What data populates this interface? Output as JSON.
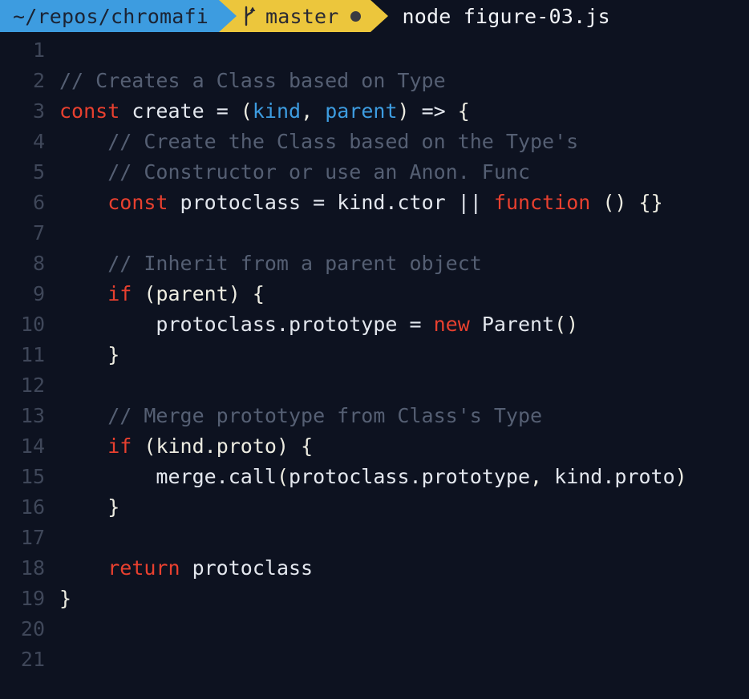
{
  "colors": {
    "background": "#0d1220",
    "path_segment": "#3d9ce0",
    "git_segment": "#ecc63c",
    "keyword": "#e8402f",
    "comment": "#555f73",
    "param": "#3d9ce0",
    "plain_text": "#e3e7ee",
    "line_number": "#3f4759",
    "dirty_dot": "#3a3a42"
  },
  "prompt": {
    "path": "~/repos/chromafi",
    "git_icon": "git-branch-icon",
    "branch": "master",
    "dirty_indicator": "●",
    "command": "node figure-03.js"
  },
  "code": {
    "lines": [
      {
        "number": "1",
        "tokens": []
      },
      {
        "number": "2",
        "tokens": [
          {
            "text": "// Creates a Class based on Type",
            "cls": "t-comment"
          }
        ]
      },
      {
        "number": "3",
        "tokens": [
          {
            "text": "const",
            "cls": "t-keyword"
          },
          {
            "text": " create ",
            "cls": "t-plain"
          },
          {
            "text": "= ",
            "cls": "t-op"
          },
          {
            "text": "(",
            "cls": "t-punct"
          },
          {
            "text": "kind",
            "cls": "t-param"
          },
          {
            "text": ", ",
            "cls": "t-punct"
          },
          {
            "text": "parent",
            "cls": "t-param"
          },
          {
            "text": ")",
            "cls": "t-punct"
          },
          {
            "text": " => ",
            "cls": "t-op"
          },
          {
            "text": "{",
            "cls": "t-punct"
          }
        ]
      },
      {
        "number": "4",
        "tokens": [
          {
            "text": "    // Create the Class based on the Type's",
            "cls": "t-comment"
          }
        ]
      },
      {
        "number": "5",
        "tokens": [
          {
            "text": "    // Constructor or use an Anon. Func",
            "cls": "t-comment"
          }
        ]
      },
      {
        "number": "6",
        "tokens": [
          {
            "text": "    ",
            "cls": "t-plain"
          },
          {
            "text": "const",
            "cls": "t-keyword"
          },
          {
            "text": " protoclass ",
            "cls": "t-plain"
          },
          {
            "text": "= ",
            "cls": "t-op"
          },
          {
            "text": "kind.ctor ",
            "cls": "t-plain"
          },
          {
            "text": "|| ",
            "cls": "t-op"
          },
          {
            "text": "function",
            "cls": "t-keyword"
          },
          {
            "text": " ",
            "cls": "t-plain"
          },
          {
            "text": "()",
            "cls": "t-punct"
          },
          {
            "text": " ",
            "cls": "t-plain"
          },
          {
            "text": "{}",
            "cls": "t-punct"
          }
        ]
      },
      {
        "number": "7",
        "tokens": []
      },
      {
        "number": "8",
        "tokens": [
          {
            "text": "    // Inherit from a parent object",
            "cls": "t-comment"
          }
        ]
      },
      {
        "number": "9",
        "tokens": [
          {
            "text": "    ",
            "cls": "t-plain"
          },
          {
            "text": "if",
            "cls": "t-keyword"
          },
          {
            "text": " ",
            "cls": "t-plain"
          },
          {
            "text": "(parent)",
            "cls": "t-punct"
          },
          {
            "text": " ",
            "cls": "t-plain"
          },
          {
            "text": "{",
            "cls": "t-punct"
          }
        ]
      },
      {
        "number": "10",
        "tokens": [
          {
            "text": "        protoclass.prototype ",
            "cls": "t-plain"
          },
          {
            "text": "= ",
            "cls": "t-op"
          },
          {
            "text": "new",
            "cls": "t-keyword"
          },
          {
            "text": " Parent",
            "cls": "t-plain"
          },
          {
            "text": "()",
            "cls": "t-punct"
          }
        ]
      },
      {
        "number": "11",
        "tokens": [
          {
            "text": "    ",
            "cls": "t-plain"
          },
          {
            "text": "}",
            "cls": "t-punct"
          }
        ]
      },
      {
        "number": "12",
        "tokens": []
      },
      {
        "number": "13",
        "tokens": [
          {
            "text": "    // Merge prototype from Class's Type",
            "cls": "t-comment"
          }
        ]
      },
      {
        "number": "14",
        "tokens": [
          {
            "text": "    ",
            "cls": "t-plain"
          },
          {
            "text": "if",
            "cls": "t-keyword"
          },
          {
            "text": " ",
            "cls": "t-plain"
          },
          {
            "text": "(kind.proto)",
            "cls": "t-punct"
          },
          {
            "text": " ",
            "cls": "t-plain"
          },
          {
            "text": "{",
            "cls": "t-punct"
          }
        ]
      },
      {
        "number": "15",
        "tokens": [
          {
            "text": "        merge.call",
            "cls": "t-plain"
          },
          {
            "text": "(",
            "cls": "t-punct"
          },
          {
            "text": "protoclass.prototype",
            "cls": "t-plain"
          },
          {
            "text": ", ",
            "cls": "t-punct"
          },
          {
            "text": "kind.proto",
            "cls": "t-plain"
          },
          {
            "text": ")",
            "cls": "t-punct"
          }
        ]
      },
      {
        "number": "16",
        "tokens": [
          {
            "text": "    ",
            "cls": "t-plain"
          },
          {
            "text": "}",
            "cls": "t-punct"
          }
        ]
      },
      {
        "number": "17",
        "tokens": []
      },
      {
        "number": "18",
        "tokens": [
          {
            "text": "    ",
            "cls": "t-plain"
          },
          {
            "text": "return",
            "cls": "t-keyword"
          },
          {
            "text": " protoclass",
            "cls": "t-plain"
          }
        ]
      },
      {
        "number": "19",
        "tokens": [
          {
            "text": "}",
            "cls": "t-punct"
          }
        ]
      },
      {
        "number": "20",
        "tokens": []
      },
      {
        "number": "21",
        "tokens": []
      }
    ]
  }
}
